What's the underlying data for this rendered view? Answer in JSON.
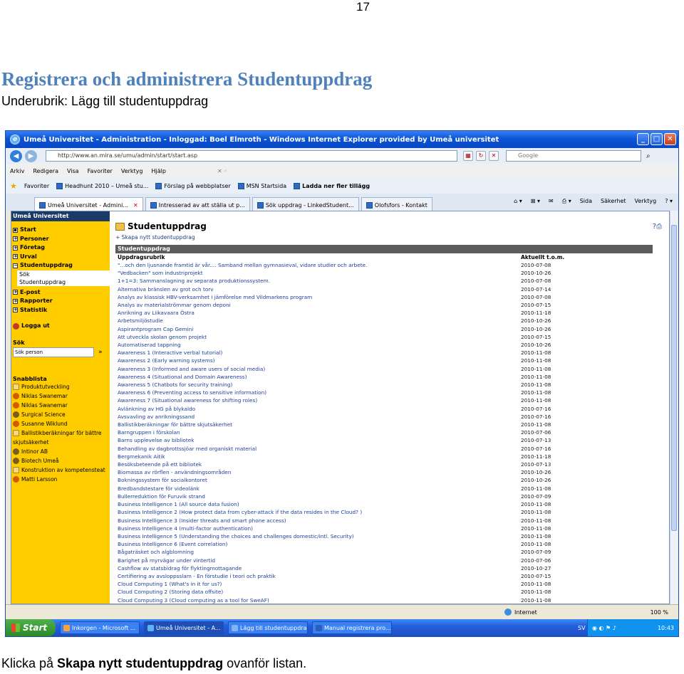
{
  "page_number": "17",
  "doc": {
    "title": "Registrera och administrera Studentuppdrag",
    "subtitle": "Underubrik: Lägg till studentuppdrag",
    "caption_prefix": "Klicka på ",
    "caption_bold": "Skapa nytt studentuppdrag",
    "caption_suffix": " ovanför listan."
  },
  "browser": {
    "window_title": "Umeå Universitet - Administration - Inloggad: Boel Elmroth - Windows Internet Explorer provided by Umeå universitet",
    "url": "http://www.an.mira.se/umu/admin/start/start.asp",
    "search_placeholder": "Google",
    "menu": [
      "Arkiv",
      "Redigera",
      "Visa",
      "Favoriter",
      "Verktyg",
      "Hjälp"
    ],
    "favorites_label": "Favoriter",
    "favorites": [
      "Headhunt 2010 – Umeå stu...",
      "Förslag på webbplatser",
      "MSN Startsida",
      "Ladda ner fler tillägg"
    ],
    "tabs": [
      "Umeå Universitet - Admini...",
      "Intresserad av att ställa ut p...",
      "Sök uppdrag - LinkedStudent...",
      "Olofsfors - Kontakt"
    ],
    "tools": [
      "Sida",
      "Säkerhet",
      "Verktyg"
    ],
    "status_zone": "Internet",
    "status_zoom": "100 %"
  },
  "sidebar": {
    "header": "Umeå Universitet",
    "nav": [
      {
        "label": "Start",
        "expand": ""
      },
      {
        "label": "Personer",
        "expand": "+"
      },
      {
        "label": "Företag",
        "expand": "+"
      },
      {
        "label": "Urval",
        "expand": "+"
      },
      {
        "label": "Studentuppdrag",
        "expand": "−"
      }
    ],
    "sub": [
      "Sök",
      "Studentuppdrag"
    ],
    "nav2": [
      {
        "label": "E-post",
        "expand": "+"
      },
      {
        "label": "Rapporter",
        "expand": "+"
      },
      {
        "label": "Statistik",
        "expand": "+"
      }
    ],
    "logout": "Logga ut",
    "search_label": "Sök",
    "search_placeholder": "Sök person",
    "search_go": "»",
    "quick_label": "Snabblista",
    "quick": [
      "Produktutveckling",
      "Niklas Swanemar",
      "Niklas Swanemar",
      "Surgical Science",
      "Susanne Wiklund",
      "Ballistikberäkningar för bättre",
      "skjutsäkerhet",
      "Intinor AB",
      "Biotech Umeå",
      "Konstruktion av kompetensteat",
      "Matti Larsson"
    ]
  },
  "main": {
    "title": "Studentuppdrag",
    "create_link": "Skapa nytt studentuppdrag",
    "table_title": "Studentuppdrag",
    "col1": "Uppdragsrubrik",
    "col2": "Aktuellt t.o.m.",
    "rows": [
      [
        "\"...och den ljusnande framtid är vår.... Samband mellan gymnasieval, vidare studier och arbete.",
        "2010-07-08"
      ],
      [
        "\"Vedbacken\" som industriprojekt",
        "2010-10-26"
      ],
      [
        "1+1=3: Sammanslagning av separata produktionssystem.",
        "2010-07-08"
      ],
      [
        "Alternativa bränslen av grot och torv",
        "2010-07-14"
      ],
      [
        "Analys av klassisk HBV-verksamhet i jämförelse med Vildmarkens program",
        "2010-07-08"
      ],
      [
        "Analys av materialströmmar genom deponi",
        "2010-07-15"
      ],
      [
        "Anrikning av Liikavaara Östra",
        "2010-11-18"
      ],
      [
        "Arbetsmiljöstudie",
        "2010-10-26"
      ],
      [
        "Aspirantprogram Cap Gemini",
        "2010-10-26"
      ],
      [
        "Att utveckla skolan genom projekt",
        "2010-07-15"
      ],
      [
        "Automatiserad tappning",
        "2010-10-26"
      ],
      [
        "Awareness 1 (Interactive verbal tutorial)",
        "2010-11-08"
      ],
      [
        "Awareness 2 (Early warning systems)",
        "2010-11-08"
      ],
      [
        "Awareness 3 (Informed and aware users of social media)",
        "2010-11-08"
      ],
      [
        "Awareness 4 (Situational and Domain Awareness)",
        "2010-11-08"
      ],
      [
        "Awareness 5 (Chatbots for security training)",
        "2010-11-08"
      ],
      [
        "Awareness 6 (Preventing access to sensitive information)",
        "2010-11-08"
      ],
      [
        "Awareness 7 (Situational awareness for shifting roles)",
        "2010-11-08"
      ],
      [
        "Avlänkning av HG på blykaldo",
        "2010-07-16"
      ],
      [
        "Avsvavling av anrikningssand",
        "2010-07-16"
      ],
      [
        "Ballistikberäkningar för bättre skjutsäkerhet",
        "2010-11-08"
      ],
      [
        "Barngruppen i förskolan",
        "2010-07-06"
      ],
      [
        "Barns upplevelse av bibliotek",
        "2010-07-13"
      ],
      [
        "Behandling av dagbrottssjöar med organiskt material",
        "2010-07-16"
      ],
      [
        "Bergmekanik Aitik",
        "2010-11-18"
      ],
      [
        "Besöksbeteende på ett bibliotek",
        "2010-07-13"
      ],
      [
        "Biomassa av rörflen - användningsområden",
        "2010-10-26"
      ],
      [
        "Bokningssystem för socialkontoret",
        "2010-10-26"
      ],
      [
        "Bredbandstestare för videolänk",
        "2010-11-08"
      ],
      [
        "Bullerreduktion för Furuvik strand",
        "2010-07-09"
      ],
      [
        "Business Intelligence 1 (All source data fusion)",
        "2010-11-08"
      ],
      [
        "Business Intelligence 2 (How protect data from cyber-attack if the data resides in the Cloud? )",
        "2010-11-08"
      ],
      [
        "Business Intelligence 3 (Insider threats and smart phone access)",
        "2010-11-08"
      ],
      [
        "Business Intelligence 4 (multi-factor authentication)",
        "2010-11-08"
      ],
      [
        "Business Intelligence 5 (Understanding the choices and challenges domestic/intl. Security)",
        "2010-11-08"
      ],
      [
        "Business Intelligence 6 (Event correlation)",
        "2010-11-08"
      ],
      [
        "Bågaträsket och algblomning",
        "2010-07-09"
      ],
      [
        "Barighet på myrvägar under vintertid",
        "2010-07-06"
      ],
      [
        "Cashflow av statsbidrag för flyktingmottagande",
        "2010-10-27"
      ],
      [
        "Certifiering av avsloppsslam - En förstudie i teori och praktik",
        "2010-07-15"
      ],
      [
        "Cloud Computing 1 (What's in it for us?)",
        "2010-11-08"
      ],
      [
        "Cloud Computing 2 (Storing data offsite)",
        "2010-11-08"
      ],
      [
        "Cloud Computing 3 (Cloud computing as a tool for SweAF)",
        "2010-11-08"
      ]
    ]
  },
  "taskbar": {
    "start": "Start",
    "tasks": [
      "Inkorgen - Microsoft ...",
      "Umeå Universitet - A...",
      "Lägg till studentuppdrag",
      "Manual registrera pro..."
    ],
    "lang": "SV",
    "clock": "10:43"
  },
  "colors": {
    "title_blue": "#4f81bd",
    "sidebar_yellow": "#ffcc00",
    "xp_blue": "#245edc"
  }
}
